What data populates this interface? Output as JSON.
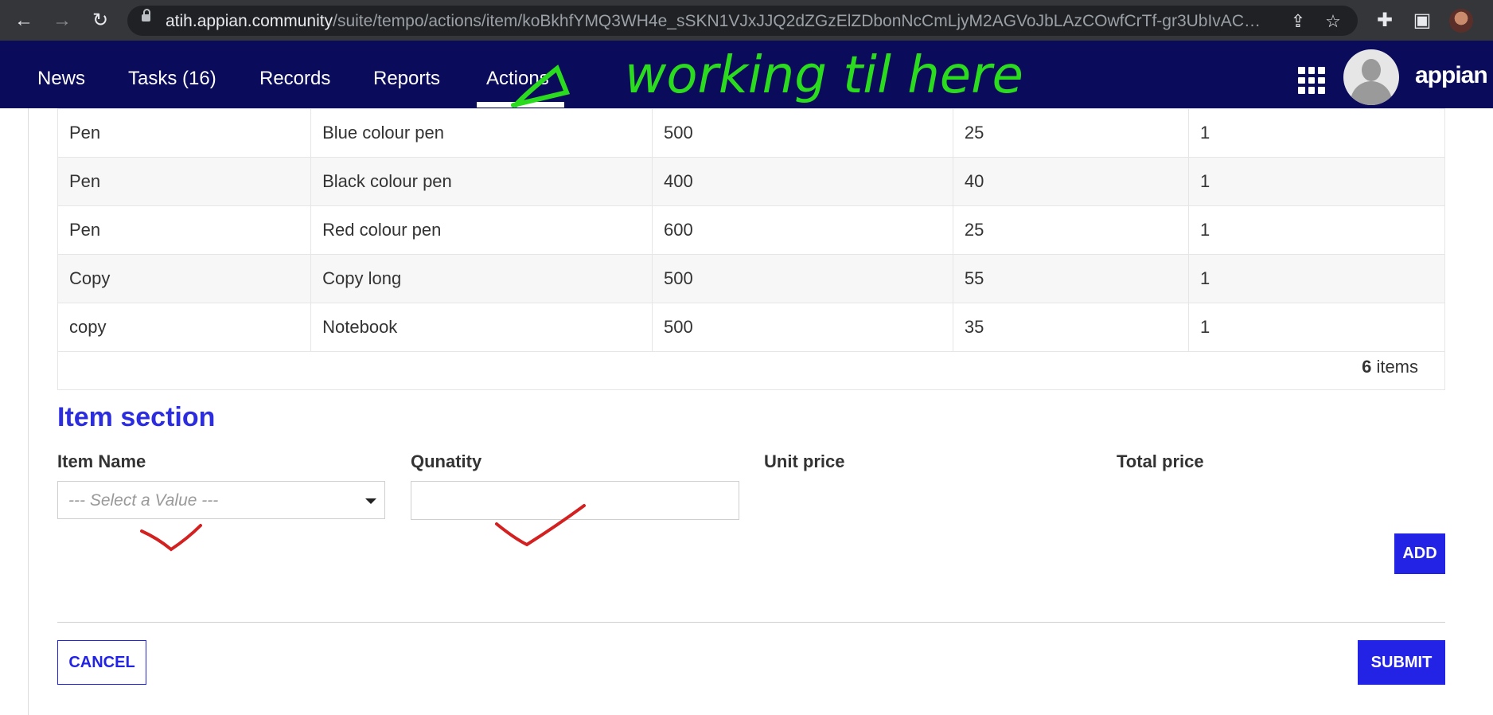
{
  "browser": {
    "url_host": "atih.appian.community",
    "url_path": "/suite/tempo/actions/item/koBkhfYMQ3WH4e_sSKN1VJxJJQ2dZGzElZDbonNcCmLjyM2AGVoJbLAzCOwfCrTf-gr3UbIvACxTobr..."
  },
  "appbar": {
    "tabs": [
      {
        "label": "News"
      },
      {
        "label": "Tasks (16)"
      },
      {
        "label": "Records"
      },
      {
        "label": "Reports"
      },
      {
        "label": "Actions"
      }
    ],
    "logo": "appian"
  },
  "table": {
    "rows": [
      [
        "Pen",
        "Blue colour pen",
        "500",
        "25",
        "1"
      ],
      [
        "Pen",
        "Black colour pen",
        "400",
        "40",
        "1"
      ],
      [
        "Pen",
        "Red colour pen",
        "600",
        "25",
        "1"
      ],
      [
        "Copy",
        "Copy long",
        "500",
        "55",
        "1"
      ],
      [
        "copy",
        "Notebook",
        "500",
        "35",
        "1"
      ]
    ],
    "count": "6",
    "count_suffix": "items"
  },
  "form": {
    "section_title": "Item section",
    "labels": {
      "item_name": "Item Name",
      "quantity": "Qunatity",
      "unit_price": "Unit price",
      "total_price": "Total price"
    },
    "item_name_placeholder": "--- Select a Value ---",
    "quantity_value": "",
    "add_label": "ADD",
    "cancel_label": "CANCEL",
    "submit_label": "SUBMIT"
  },
  "annotations": {
    "handwritten_note": "working til here",
    "note_color": "#2bdc1e",
    "checkmark_color": "#d32020"
  },
  "icons": [
    "back-icon",
    "forward-icon",
    "reload-icon",
    "lock-icon",
    "share-icon",
    "star-icon",
    "extensions-icon",
    "sidebar-icon",
    "apps-grid-icon",
    "user-avatar-icon",
    "dropdown-caret-icon"
  ]
}
